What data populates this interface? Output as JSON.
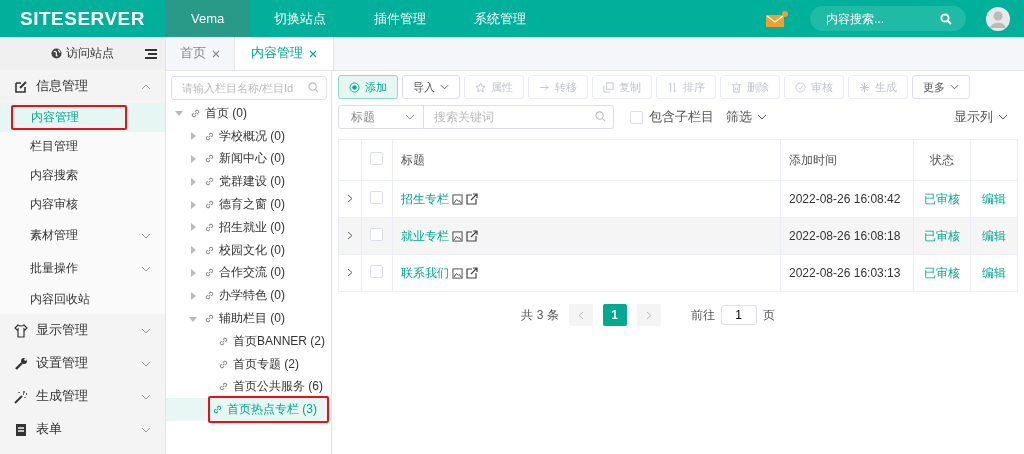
{
  "header": {
    "logo": "SITESERVER",
    "nav": [
      {
        "label": "Vema",
        "selected": true
      },
      {
        "label": "切换站点",
        "selected": false
      },
      {
        "label": "插件管理",
        "selected": false
      },
      {
        "label": "系统管理",
        "selected": false
      }
    ],
    "mail_unread": true,
    "search": {
      "placeholder": "内容搜索..."
    }
  },
  "sidebar": {
    "visit_site": "访问站点",
    "groups": [
      {
        "label": "信息管理",
        "expanded": true,
        "items": [
          {
            "label": "内容管理",
            "selected": true,
            "highlighted": true,
            "has_children": false
          },
          {
            "label": "栏目管理",
            "selected": false,
            "highlighted": false,
            "has_children": false
          },
          {
            "label": "内容搜索",
            "selected": false,
            "highlighted": false,
            "has_children": false
          },
          {
            "label": "内容审核",
            "selected": false,
            "highlighted": false,
            "has_children": false
          },
          {
            "label": "素材管理",
            "selected": false,
            "highlighted": false,
            "has_children": true
          },
          {
            "label": "批量操作",
            "selected": false,
            "highlighted": false,
            "has_children": true
          },
          {
            "label": "内容回收站",
            "selected": false,
            "highlighted": false,
            "has_children": false
          }
        ]
      },
      {
        "label": "显示管理",
        "expanded": false
      },
      {
        "label": "设置管理",
        "expanded": false
      },
      {
        "label": "生成管理",
        "expanded": false
      },
      {
        "label": "表单",
        "expanded": false
      }
    ]
  },
  "tabs": [
    {
      "label": "首页",
      "selected": false
    },
    {
      "label": "内容管理",
      "selected": true
    }
  ],
  "tree": {
    "placeholder": "请输入栏目名称/栏目Id",
    "nodes": [
      {
        "label": "首页 (0)",
        "expanded": true,
        "selected": false,
        "highlighted": false,
        "children": [
          {
            "label": "学校概况 (0)",
            "expanded": false,
            "selected": false,
            "highlighted": false,
            "has_children": true
          },
          {
            "label": "新闻中心 (0)",
            "expanded": false,
            "selected": false,
            "highlighted": false,
            "has_children": true
          },
          {
            "label": "党群建设 (0)",
            "expanded": false,
            "selected": false,
            "highlighted": false,
            "has_children": true
          },
          {
            "label": "德育之窗 (0)",
            "expanded": false,
            "selected": false,
            "highlighted": false,
            "has_children": true
          },
          {
            "label": "招生就业 (0)",
            "expanded": false,
            "selected": false,
            "highlighted": false,
            "has_children": true
          },
          {
            "label": "校园文化 (0)",
            "expanded": false,
            "selected": false,
            "highlighted": false,
            "has_children": true
          },
          {
            "label": "合作交流 (0)",
            "expanded": false,
            "selected": false,
            "highlighted": false,
            "has_children": true
          },
          {
            "label": "办学特色 (0)",
            "expanded": false,
            "selected": false,
            "highlighted": false,
            "has_children": true
          },
          {
            "label": "辅助栏目 (0)",
            "expanded": true,
            "selected": false,
            "highlighted": false,
            "has_children": true,
            "children": [
              {
                "label": "首页BANNER (2)",
                "selected": false,
                "highlighted": false
              },
              {
                "label": "首页专题 (2)",
                "selected": false,
                "highlighted": false
              },
              {
                "label": "首页公共服务 (6)",
                "selected": false,
                "highlighted": false
              },
              {
                "label": "首页热点专栏 (3)",
                "selected": true,
                "highlighted": true
              }
            ]
          }
        ],
        "has_children": true
      }
    ]
  },
  "toolbar": [
    {
      "label": "添加",
      "kind": "primary",
      "disabled": false,
      "dropdown": false
    },
    {
      "label": "导入",
      "kind": "plain",
      "disabled": false,
      "dropdown": true
    },
    {
      "label": "属性",
      "kind": "plain",
      "disabled": true,
      "dropdown": false
    },
    {
      "label": "转移",
      "kind": "plain",
      "disabled": true,
      "dropdown": false
    },
    {
      "label": "复制",
      "kind": "plain",
      "disabled": true,
      "dropdown": false
    },
    {
      "label": "排序",
      "kind": "plain",
      "disabled": true,
      "dropdown": false
    },
    {
      "label": "删除",
      "kind": "plain",
      "disabled": true,
      "dropdown": false
    },
    {
      "label": "审核",
      "kind": "plain",
      "disabled": true,
      "dropdown": false
    },
    {
      "label": "生成",
      "kind": "plain",
      "disabled": true,
      "dropdown": false
    },
    {
      "label": "更多",
      "kind": "plain",
      "disabled": false,
      "dropdown": true
    }
  ],
  "filter": {
    "field": "标题",
    "placeholder": "搜索关键词",
    "include_children": {
      "label": "包含子栏目",
      "checked": false
    },
    "filter_label": "筛选",
    "columns_label": "显示列"
  },
  "table": {
    "all_checked": false,
    "columns": [
      "标题",
      "添加时间",
      "状态"
    ],
    "rows": [
      {
        "title": "招生专栏",
        "time": "2022-08-26 16:08:42",
        "status": "已审核",
        "action": "编辑",
        "checked": false
      },
      {
        "title": "就业专栏",
        "time": "2022-08-26 16:08:18",
        "status": "已审核",
        "action": "编辑",
        "checked": false
      },
      {
        "title": "联系我们",
        "time": "2022-08-26 16:03:13",
        "status": "已审核",
        "action": "编辑",
        "checked": false
      }
    ]
  },
  "pagination": {
    "total": "共 3 条",
    "pages": [
      {
        "label": "1",
        "selected": true
      }
    ],
    "goto_label": "前往",
    "goto_value": "1",
    "page_suffix": "页"
  }
}
